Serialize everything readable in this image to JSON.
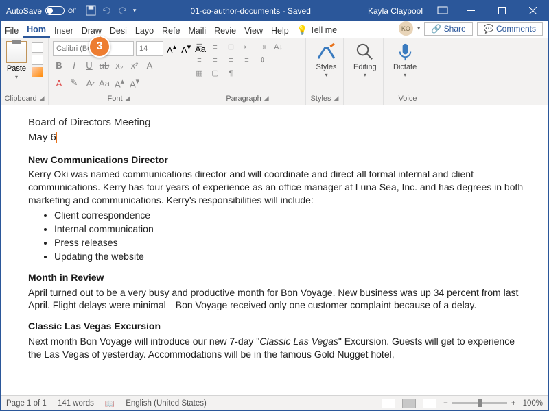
{
  "titlebar": {
    "autosave": "AutoSave",
    "autosave_state": "Off",
    "doc_name": "01-co-author-documents - Saved",
    "user": "Kayla Claypool"
  },
  "tabs": {
    "file": "File",
    "home": "Hom",
    "insert": "Inser",
    "draw": "Draw",
    "design": "Desi",
    "layout": "Layo",
    "references": "Refe",
    "mailings": "Maili",
    "review": "Revie",
    "view": "View",
    "help": "Help",
    "tell_me": "Tell me",
    "avatar": "KO",
    "share": "Share",
    "comments": "Comments"
  },
  "ribbon": {
    "paste": "Paste",
    "clipboard": "Clipboard",
    "font_placeholder": "Calibri (Body)",
    "size_placeholder": "14",
    "font_label": "Font",
    "paragraph_label": "Paragraph",
    "styles_label": "Styles",
    "styles": "Styles",
    "editing": "Editing",
    "dictate": "Dictate",
    "voice_label": "Voice"
  },
  "document": {
    "title": "Board of Directors Meeting",
    "date_text": "May 6",
    "h1": "New Communications Director",
    "p1": "Kerry Oki was named communications director and will coordinate and direct all formal internal and client communications. Kerry has four years of experience as an office manager at Luna Sea, Inc. and has degrees in both marketing and communications. Kerry's responsibilities will include:",
    "bullets": [
      "Client correspondence",
      "Internal communication",
      "Press releases",
      "Updating the website"
    ],
    "h2": "Month in Review",
    "p2": "April turned out to be a very busy and productive month for Bon Voyage. New business was up 34 percent from last April. Flight delays were minimal—Bon Voyage received only one customer complaint because of a delay.",
    "h3": "Classic Las Vegas Excursion",
    "p3a": "Next month Bon Voyage will introduce our new 7-day \"",
    "p3i": "Classic Las Vegas",
    "p3b": "\" Excursion. Guests will get to experience the Las Vegas of yesterday. Accommodations will be in the famous Gold Nugget hotel,"
  },
  "callouts": {
    "c3": "3"
  },
  "status": {
    "page": "Page 1 of 1",
    "words": "141 words",
    "lang": "English (United States)",
    "zoom": "100%"
  },
  "edit_tag": "mx"
}
